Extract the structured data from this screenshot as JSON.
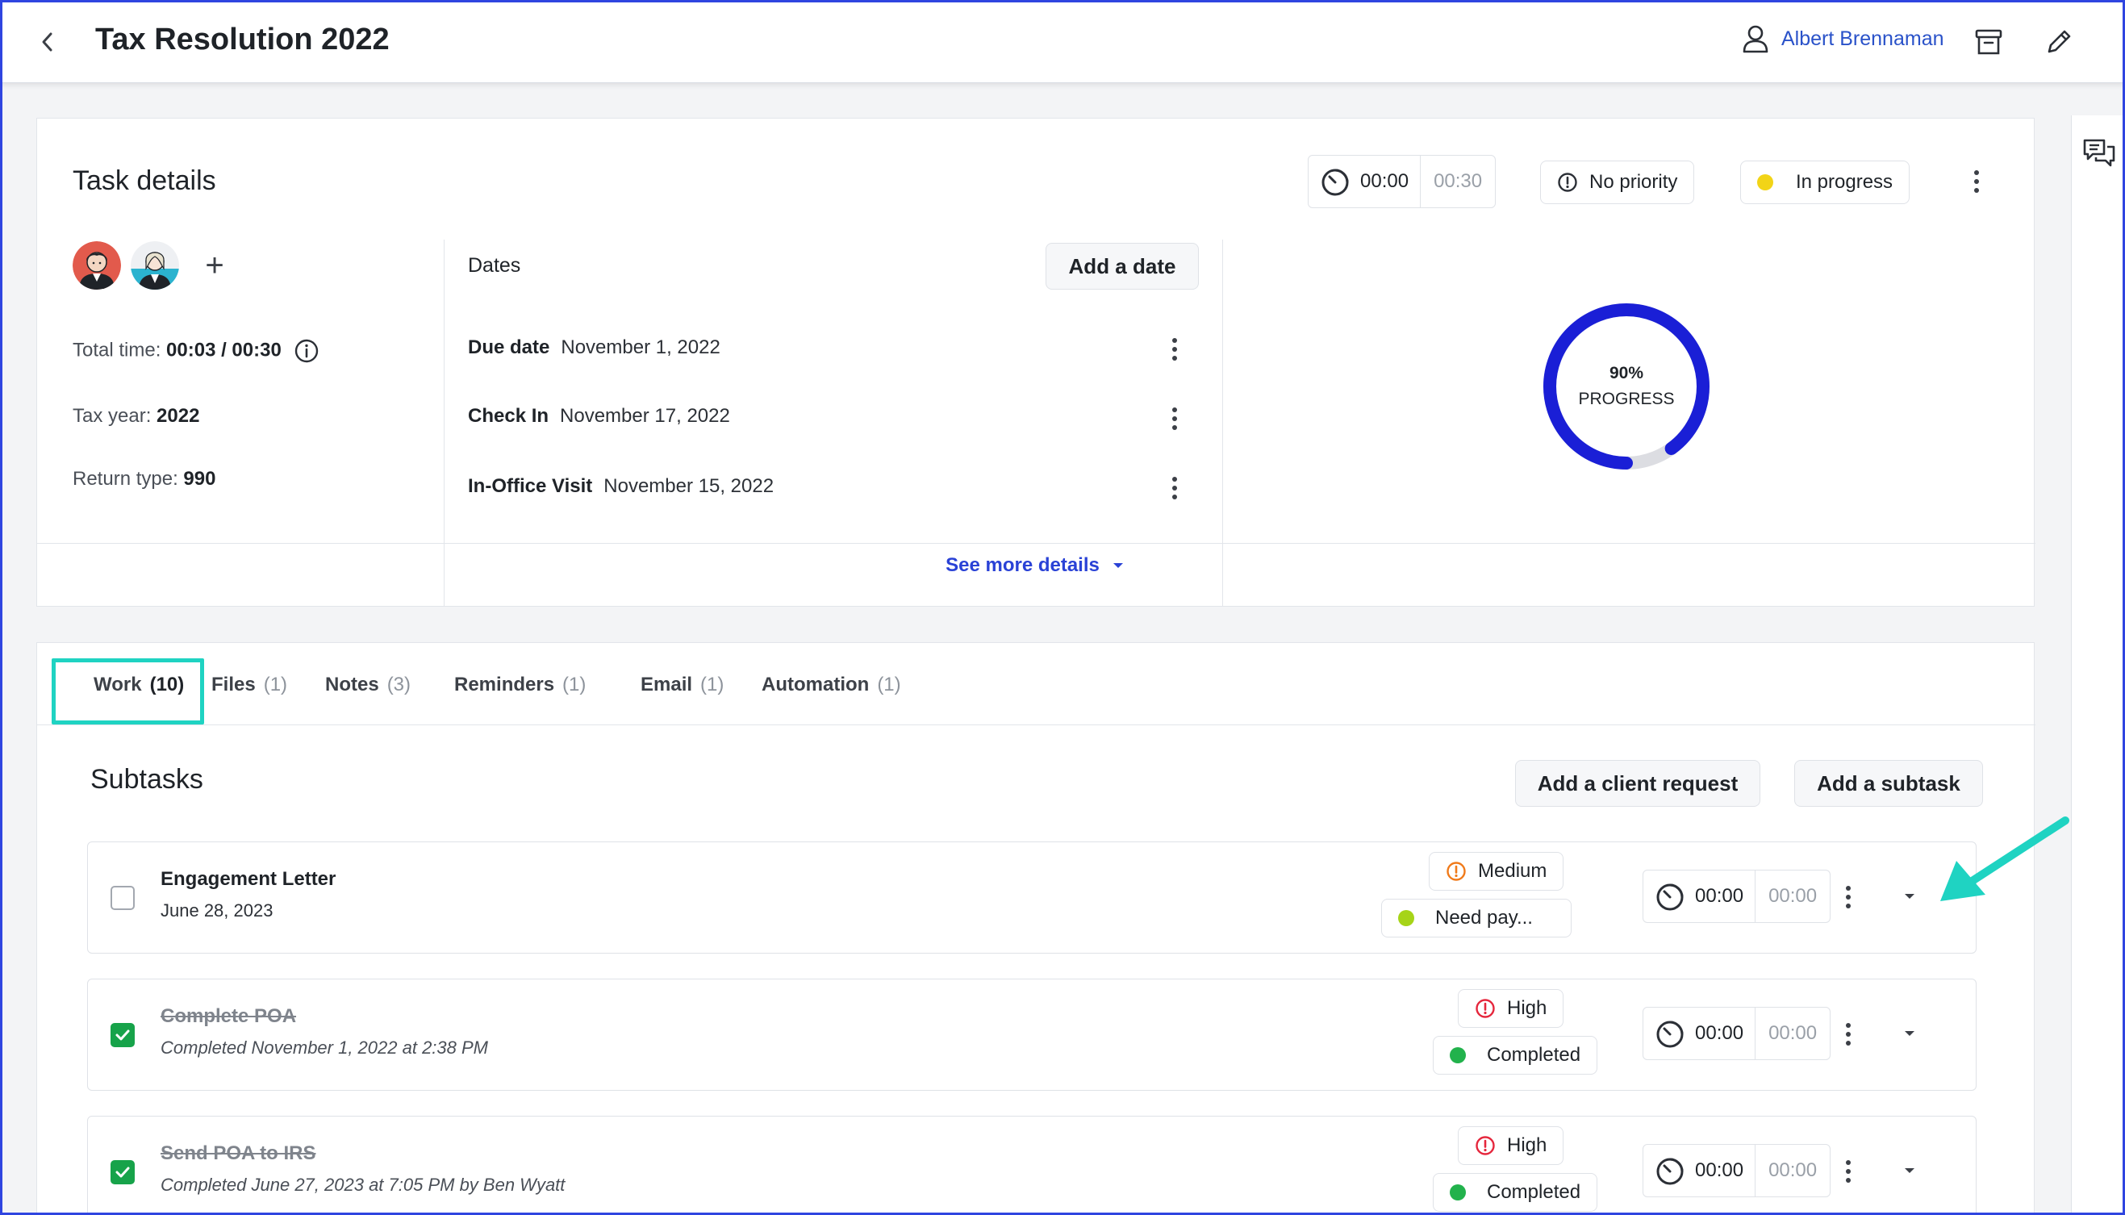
{
  "header": {
    "title": "Tax Resolution 2022",
    "user_name": "Albert Brennaman",
    "icons": [
      "chevron-left-icon",
      "user-icon",
      "archive-icon",
      "pencil-icon"
    ]
  },
  "task_details": {
    "title": "Task details",
    "timer": {
      "elapsed": "00:00",
      "estimate": "00:30"
    },
    "priority": {
      "label": "No priority",
      "icon": "alert-circle-icon"
    },
    "status": {
      "label": "In progress",
      "color": "#f2d417"
    },
    "total_time": {
      "label": "Total time:",
      "value": "00:03 / 00:30"
    },
    "tax_year": {
      "label": "Tax year:",
      "value": "2022"
    },
    "return_type": {
      "label": "Return type:",
      "value": "990"
    },
    "dates": {
      "label": "Dates",
      "add_button": "Add a date",
      "items": [
        {
          "name": "Due date",
          "value": "November 1, 2022"
        },
        {
          "name": "Check In",
          "value": "November 17, 2022"
        },
        {
          "name": "In-Office Visit",
          "value": "November 15, 2022"
        }
      ]
    },
    "progress": {
      "percent_label": "90%",
      "label": "PROGRESS",
      "value": 0.9,
      "color": "#1a1fd6"
    },
    "see_more": "See more details"
  },
  "tabs": [
    {
      "label": "Work",
      "count": "(10)",
      "active": true
    },
    {
      "label": "Files",
      "count": "(1)"
    },
    {
      "label": "Notes",
      "count": "(3)"
    },
    {
      "label": "Reminders",
      "count": "(1)"
    },
    {
      "label": "Email",
      "count": "(1)"
    },
    {
      "label": "Automation",
      "count": "(1)"
    }
  ],
  "subtasks": {
    "title": "Subtasks",
    "add_client_request": "Add a client request",
    "add_subtask": "Add a subtask",
    "items": [
      {
        "title": "Engagement Letter",
        "subtitle": "June 28, 2023",
        "done": false,
        "priority": "Medium",
        "priority_color": "#f07a1a",
        "status": "Need pay...",
        "status_color": "#a6d418",
        "timer": {
          "elapsed": "00:00",
          "estimate": "00:00"
        }
      },
      {
        "title": "Complete POA",
        "subtitle": "Completed November 1, 2022 at 2:38 PM",
        "done": true,
        "priority": "High",
        "priority_color": "#e5263c",
        "status": "Completed",
        "status_color": "#22b24c",
        "timer": {
          "elapsed": "00:00",
          "estimate": "00:00"
        }
      },
      {
        "title": "Send POA to IRS",
        "subtitle": "Completed June 27, 2023 at 7:05 PM by Ben Wyatt",
        "done": true,
        "priority": "High",
        "priority_color": "#e5263c",
        "status": "Completed",
        "status_color": "#22b24c",
        "timer": {
          "elapsed": "00:00",
          "estimate": "00:00"
        }
      }
    ]
  },
  "colors": {
    "accent": "#2a42d6",
    "highlight": "#1fd3c2",
    "frame": "#2f45e0"
  }
}
